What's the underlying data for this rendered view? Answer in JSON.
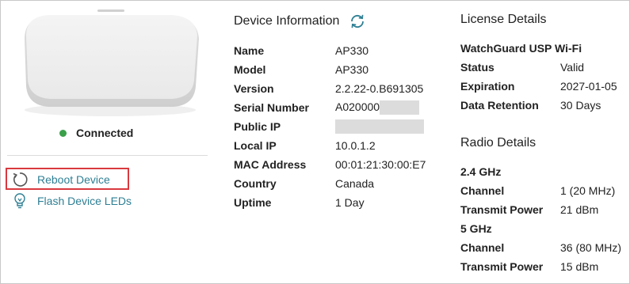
{
  "device": {
    "status_label": "Connected",
    "status_color": "#3aa04a"
  },
  "actions": {
    "reboot_label": "Reboot Device",
    "flash_label": "Flash Device LEDs"
  },
  "device_info": {
    "title": "Device Information",
    "rows": [
      {
        "label": "Name",
        "value": "AP330"
      },
      {
        "label": "Model",
        "value": "AP330"
      },
      {
        "label": "Version",
        "value": "2.2.22-0.B691305"
      },
      {
        "label": "Serial Number",
        "value": "A020000"
      },
      {
        "label": "Public IP",
        "value": ""
      },
      {
        "label": "Local IP",
        "value": "10.0.1.2"
      },
      {
        "label": "MAC Address",
        "value": "00:01:21:30:00:E7"
      },
      {
        "label": "Country",
        "value": "Canada"
      },
      {
        "label": "Uptime",
        "value": "1 Day"
      }
    ]
  },
  "license": {
    "title": "License Details",
    "product": "WatchGuard USP Wi-Fi",
    "rows": [
      {
        "label": "Status",
        "value": "Valid"
      },
      {
        "label": "Expiration",
        "value": "2027-01-05"
      },
      {
        "label": "Data Retention",
        "value": "30 Days"
      }
    ]
  },
  "radio": {
    "title": "Radio Details",
    "bands": [
      {
        "name": "2.4 GHz",
        "rows": [
          {
            "label": "Channel",
            "value": "1 (20 MHz)"
          },
          {
            "label": "Transmit Power",
            "value": "21 dBm"
          }
        ]
      },
      {
        "name": "5 GHz",
        "rows": [
          {
            "label": "Channel",
            "value": "36 (80 MHz)"
          },
          {
            "label": "Transmit Power",
            "value": "15 dBm"
          }
        ]
      }
    ]
  },
  "colors": {
    "link": "#2e7f94",
    "highlight": "#d9393e",
    "connected": "#3aa04a"
  },
  "icons": {
    "refresh": "refresh-icon",
    "reboot": "reboot-icon",
    "flash": "flash-led-icon"
  }
}
